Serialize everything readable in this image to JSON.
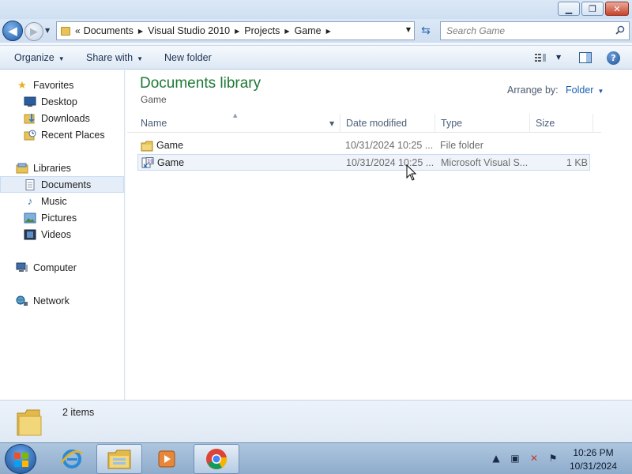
{
  "window": {
    "minimize_glyph": "▁",
    "maximize_glyph": "❐",
    "close_glyph": "✕"
  },
  "navigation": {
    "back_glyph": "◀",
    "forward_glyph": "▶",
    "address_prefix": "«",
    "breadcrumbs": [
      "Documents",
      "Visual Studio 2010",
      "Projects",
      "Game"
    ],
    "search_placeholder": "Search Game"
  },
  "toolbar": {
    "organize": "Organize",
    "share_with": "Share with",
    "new_folder": "New folder",
    "help_glyph": "?"
  },
  "sidebar": {
    "favorites": "Favorites",
    "desktop": "Desktop",
    "downloads": "Downloads",
    "recent_places": "Recent Places",
    "libraries": "Libraries",
    "documents": "Documents",
    "music": "Music",
    "pictures": "Pictures",
    "videos": "Videos",
    "computer": "Computer",
    "network": "Network"
  },
  "content": {
    "library_title": "Documents library",
    "library_subtitle": "Game",
    "arrange_label": "Arrange by:",
    "arrange_value": "Folder",
    "columns": {
      "name": "Name",
      "date_modified": "Date modified",
      "type": "Type",
      "size": "Size"
    },
    "files": [
      {
        "name": "Game",
        "date_modified": "10/31/2024 10:25 ...",
        "type": "File folder",
        "size": "",
        "icon": "folder-icon"
      },
      {
        "name": "Game",
        "date_modified": "10/31/2024 10:25 ...",
        "type": "Microsoft Visual S...",
        "size": "1 KB",
        "icon": "vs-solution-icon"
      }
    ]
  },
  "details": {
    "item_count": "2 items"
  },
  "taskbar": {
    "time": "10:26 PM",
    "date": "10/31/2024"
  },
  "colors": {
    "library_title": "#1f7a36",
    "link_blue": "#1a5fb4",
    "selection": "#e5eef8"
  }
}
